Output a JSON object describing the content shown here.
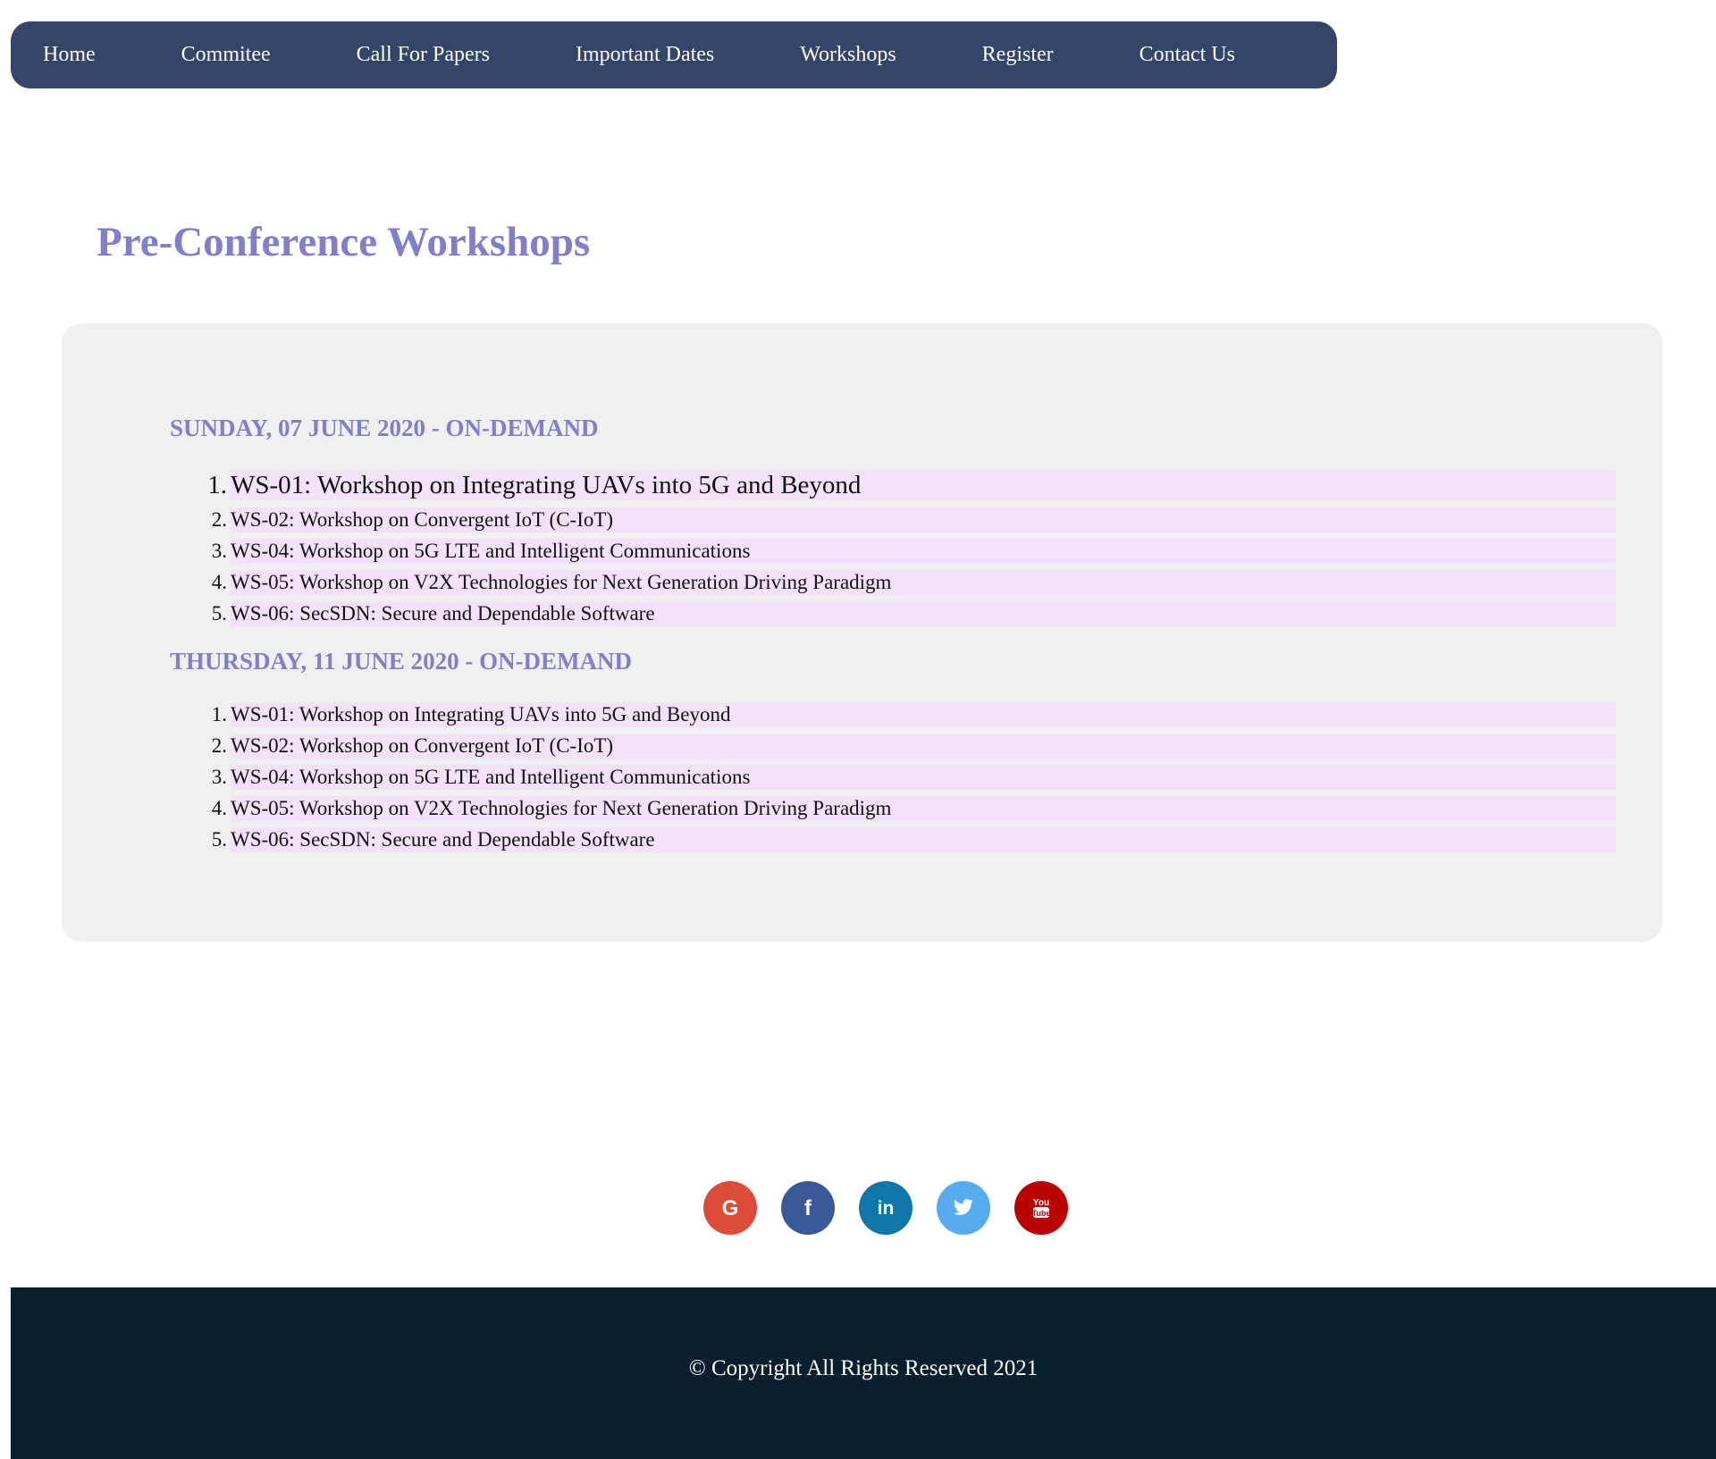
{
  "nav": {
    "items": [
      "Home",
      "Commitee",
      "Call For Papers",
      "Important Dates",
      "Workshops",
      "Register",
      "Contact Us"
    ]
  },
  "main": {
    "title": "Pre-Conference Workshops",
    "days": [
      {
        "heading": "SUNDAY, 07 JUNE 2020 - ON-DEMAND",
        "workshops": [
          "WS-01: Workshop on Integrating UAVs into 5G and Beyond",
          "WS-02: Workshop on Convergent IoT (C-IoT)",
          "WS-04: Workshop on 5G LTE and Intelligent Communications",
          "WS-05: Workshop on V2X Technologies for Next Generation Driving Paradigm",
          "WS-06: SecSDN: Secure and Dependable Software"
        ]
      },
      {
        "heading": "THURSDAY, 11 JUNE 2020 - ON-DEMAND",
        "workshops": [
          "WS-01: Workshop on Integrating UAVs into 5G and Beyond",
          "WS-02: Workshop on Convergent IoT (C-IoT)",
          "WS-04: Workshop on 5G LTE and Intelligent Communications",
          "WS-05: Workshop on V2X Technologies for Next Generation Driving Paradigm",
          "WS-06: SecSDN: Secure and Dependable Software"
        ]
      }
    ],
    "numbers": [
      "1.",
      "2.",
      "3.",
      "4.",
      "5."
    ]
  },
  "social": [
    {
      "name": "google-icon",
      "glyph": "G",
      "color": "#dd4b39"
    },
    {
      "name": "facebook-icon",
      "glyph": "f",
      "color": "#3b5998"
    },
    {
      "name": "linkedin-icon",
      "glyph": "in",
      "color": "#0e76a8"
    },
    {
      "name": "twitter-icon",
      "glyph": "t",
      "color": "#55acee"
    },
    {
      "name": "youtube-icon",
      "glyph": "You",
      "color": "#bb0000"
    }
  ],
  "footer": {
    "copyright": "© Copyright All Rights Reserved 2021"
  },
  "colors": {
    "nav_bg": "#334569",
    "title": "#7f7fcc",
    "panel_bg": "#f0f0f0",
    "item_highlight": "#f4e1fb",
    "footer_bg": "#0a1f2e"
  }
}
